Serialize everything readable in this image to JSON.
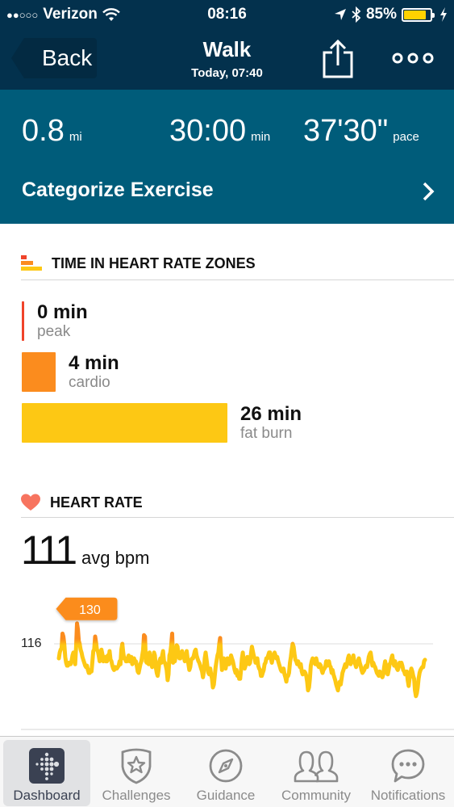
{
  "status_bar": {
    "signal": "●●○○○",
    "carrier": "Verizon",
    "time": "08:16",
    "battery_percent": "85%",
    "battery_level": 0.85,
    "battery_color": "#ffd200"
  },
  "nav": {
    "back_label": "Back",
    "title": "Walk",
    "subtitle": "Today, 07:40",
    "share_icon": "share-icon",
    "more_icon": "more-icon"
  },
  "summary": {
    "distance": {
      "value": "0.8",
      "unit": "mi"
    },
    "duration": {
      "value": "30:00",
      "unit": "min"
    },
    "pace": {
      "value": "37'30\"",
      "unit": "pace"
    },
    "categorize_label": "Categorize Exercise"
  },
  "zones": {
    "title": "TIME IN HEART RATE ZONES",
    "items": [
      {
        "value": "0 min",
        "label": "peak",
        "minutes": 0,
        "color": "#f0432a"
      },
      {
        "value": "4 min",
        "label": "cardio",
        "minutes": 4,
        "color": "#fb8c1e"
      },
      {
        "value": "26 min",
        "label": "fat burn",
        "minutes": 26,
        "color": "#fdc814"
      }
    ]
  },
  "heart_rate": {
    "title": "HEART RATE",
    "avg_value": "111",
    "avg_unit": "avg bpm",
    "peak_flag": "130"
  },
  "chart_data": {
    "type": "line",
    "title": "Heart Rate",
    "ylabel": "bpm",
    "y_ticks": [
      "116"
    ],
    "reference_line": 116,
    "peak_label": 130,
    "ylim": [
      76,
      134
    ],
    "colors": {
      "low": "#fdc814",
      "high": "#fb8c1e"
    },
    "values": [
      106,
      110,
      112,
      113,
      123,
      121,
      116,
      107,
      103,
      101,
      101,
      103,
      102,
      102,
      104,
      108,
      110,
      109,
      102,
      114,
      130,
      126,
      118,
      116,
      112,
      110,
      107,
      105,
      103,
      101,
      100,
      101,
      98,
      96,
      96,
      98,
      97,
      104,
      111,
      112,
      121,
      117,
      112,
      111,
      108,
      104,
      109,
      112,
      109,
      104,
      106,
      107,
      104,
      104,
      108,
      106,
      111,
      105,
      104,
      101,
      99,
      98,
      100,
      99,
      99,
      100,
      101,
      104,
      102,
      112,
      116,
      110,
      106,
      106,
      104,
      104,
      106,
      108,
      104,
      106,
      107,
      102,
      104,
      106,
      103,
      104,
      101,
      97,
      96,
      99,
      102,
      104,
      108,
      112,
      122,
      121,
      104,
      103,
      105,
      102,
      110,
      104,
      102,
      100,
      105,
      110,
      108,
      100,
      96,
      94,
      98,
      104,
      106,
      103,
      108,
      111,
      104,
      103,
      101,
      98,
      91,
      95,
      108,
      110,
      115,
      123,
      103,
      106,
      104,
      108,
      115,
      114,
      108,
      106,
      106,
      110,
      111,
      108,
      107,
      104,
      106,
      111,
      106,
      102,
      98,
      100,
      105,
      106,
      106,
      108,
      111,
      112,
      108,
      106,
      104,
      103,
      101,
      99,
      97,
      93,
      97,
      106,
      110,
      105,
      100,
      96,
      95,
      99,
      95,
      92,
      86,
      88,
      94,
      100,
      104,
      108,
      110,
      116,
      120,
      107,
      98,
      104,
      106,
      101,
      99,
      103,
      106,
      102,
      102,
      104,
      108,
      106,
      104,
      101,
      98,
      96,
      98,
      94,
      96,
      92,
      92,
      98,
      106,
      110,
      104,
      99,
      101,
      104,
      107,
      104,
      102,
      103,
      109,
      114,
      111,
      108,
      106,
      103,
      104,
      106,
      101,
      99,
      98,
      94,
      94,
      96,
      98,
      102,
      103,
      106,
      106,
      108,
      110,
      110,
      106,
      103,
      106,
      108,
      110,
      108,
      106,
      107,
      104,
      102,
      100,
      98,
      97,
      98,
      99,
      95,
      93,
      90,
      94,
      94,
      96,
      103,
      107,
      112,
      116,
      114,
      109,
      105,
      104,
      102,
      104,
      102,
      100,
      102,
      97,
      95,
      96,
      97,
      96,
      94,
      90,
      84,
      86,
      92,
      101,
      104,
      106,
      104,
      103,
      102,
      106,
      103,
      101,
      100,
      102,
      101,
      98,
      96,
      98,
      99,
      100,
      104,
      101,
      102,
      104,
      101,
      100,
      96,
      98,
      95,
      93,
      91,
      88,
      86,
      84,
      88,
      90,
      88,
      92,
      96,
      98,
      100,
      102,
      100,
      102,
      106,
      108,
      104,
      102,
      104,
      104,
      108,
      104,
      102,
      100,
      102,
      104,
      106,
      103,
      101,
      98,
      96,
      97,
      98,
      100,
      101,
      100,
      103,
      107,
      109,
      110,
      106,
      101,
      103,
      101,
      100,
      98,
      96,
      95,
      94,
      97,
      96,
      94,
      93,
      95,
      100,
      104,
      101,
      96,
      95,
      98,
      102,
      103,
      106,
      108,
      103,
      101,
      104,
      101,
      99,
      98,
      100,
      103,
      102,
      103,
      101,
      98,
      97,
      95,
      96,
      97,
      91,
      87,
      92,
      96,
      99,
      97,
      94,
      92,
      84,
      80,
      82,
      86,
      92,
      96,
      98,
      99,
      100,
      100,
      104,
      105
    ]
  },
  "tabbar": {
    "items": [
      {
        "label": "Dashboard",
        "icon": "dashboard-icon",
        "active": true
      },
      {
        "label": "Challenges",
        "icon": "challenges-icon",
        "active": false
      },
      {
        "label": "Guidance",
        "icon": "compass-icon",
        "active": false
      },
      {
        "label": "Community",
        "icon": "community-icon",
        "active": false
      },
      {
        "label": "Notifications",
        "icon": "notifications-icon",
        "active": false
      }
    ]
  }
}
